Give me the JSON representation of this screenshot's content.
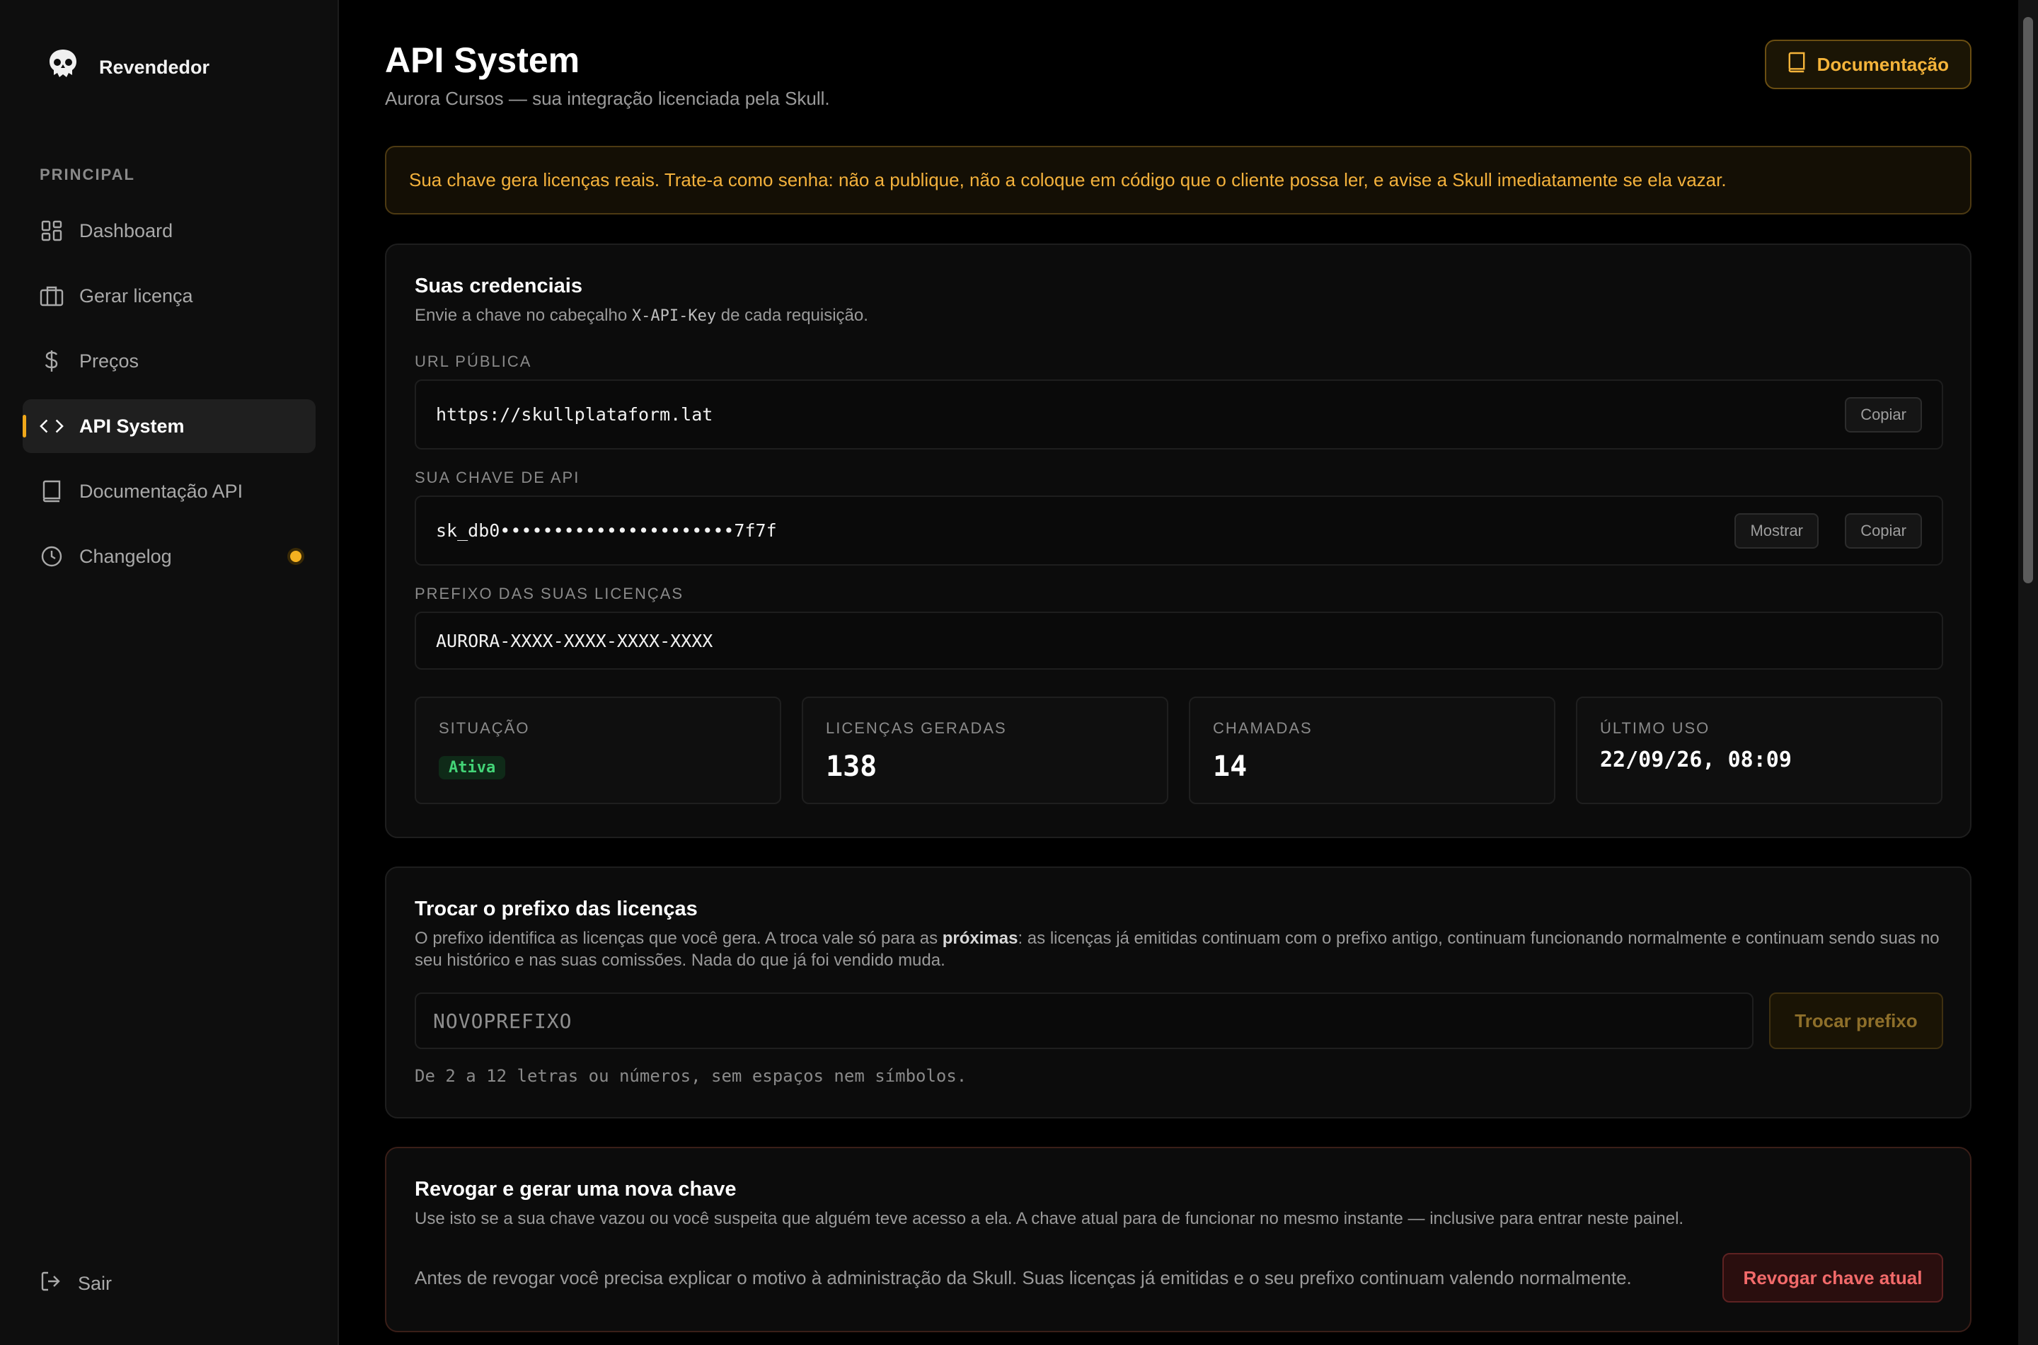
{
  "sidebar": {
    "brand": "Revendedor",
    "section": "PRINCIPAL",
    "items": [
      {
        "label": "Dashboard",
        "icon": "grid-icon"
      },
      {
        "label": "Gerar licença",
        "icon": "briefcase-icon"
      },
      {
        "label": "Preços",
        "icon": "dollar-icon"
      },
      {
        "label": "API System",
        "icon": "code-icon",
        "active": true
      },
      {
        "label": "Documentação API",
        "icon": "book-icon"
      },
      {
        "label": "Changelog",
        "icon": "clock-icon",
        "badge_dot": true
      }
    ],
    "logout": "Sair"
  },
  "header": {
    "title": "API System",
    "subtitle": "Aurora Cursos — sua integração licenciada pela Skull.",
    "doc_button": "Documentação"
  },
  "warning": "Sua chave gera licenças reais. Trate-a como senha: não a publique, não a coloque em código que o cliente possa ler, e avise a Skull imediatamente se ela vazar.",
  "credentials": {
    "title": "Suas credenciais",
    "sub_before": "Envie a chave no cabeçalho ",
    "sub_code": "X-API-Key",
    "sub_after": " de cada requisição.",
    "url_label": "URL PÚBLICA",
    "url_value": "https://skullplataform.lat",
    "copy_label": "Copiar",
    "key_label": "SUA CHAVE DE API",
    "key_value": "sk_db0••••••••••••••••••••••7f7f",
    "show_label": "Mostrar",
    "prefix_label": "PREFIXO DAS SUAS LICENÇAS",
    "prefix_value": "AURORA-XXXX-XXXX-XXXX-XXXX",
    "stats": {
      "status_label": "SITUAÇÃO",
      "status_value": "Ativa",
      "licenses_label": "LICENÇAS GERADAS",
      "licenses_value": "138",
      "calls_label": "CHAMADAS",
      "calls_value": "14",
      "last_use_label": "ÚLTIMO USO",
      "last_use_value": "22/09/26, 08:09"
    }
  },
  "prefix_change": {
    "title": "Trocar o prefixo das licenças",
    "desc_before": "O prefixo identifica as licenças que você gera. A troca vale só para as ",
    "desc_bold": "próximas",
    "desc_after": ": as licenças já emitidas continuam com o prefixo antigo, continuam funcionando normalmente e continuam sendo suas no seu histórico e nas suas comissões. Nada do que já foi vendido muda.",
    "input_placeholder": "NOVOPREFIXO",
    "button": "Trocar prefixo",
    "hint": "De 2 a 12 letras ou números, sem espaços nem símbolos."
  },
  "revoke": {
    "title": "Revogar e gerar uma nova chave",
    "desc": "Use isto se a sua chave vazou ou você suspeita que alguém teve acesso a ela. A chave atual para de funcionar no mesmo instante — inclusive para entrar neste painel.",
    "note": "Antes de revogar você precisa explicar o motivo à administração da Skull. Suas licenças já emitidas e o seu prefixo continuam valendo normalmente.",
    "button": "Revogar chave atual"
  },
  "colors": {
    "accent": "#f0a81a",
    "danger": "#f26a6a",
    "success": "#43d477"
  }
}
